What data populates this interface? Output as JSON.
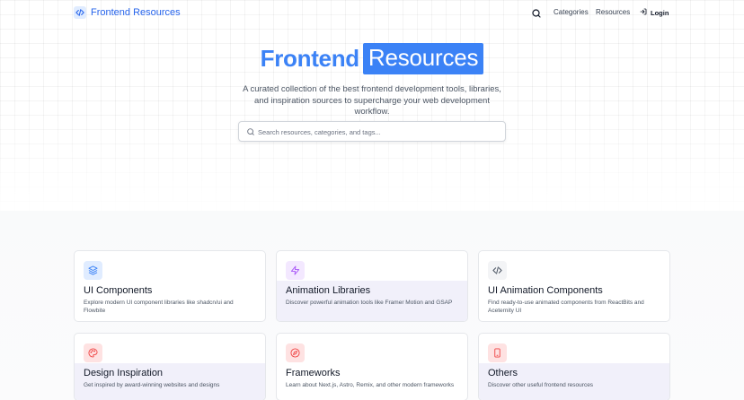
{
  "header": {
    "brand": "Frontend Resources",
    "nav": {
      "categories": "Categories",
      "resources": "Resources",
      "login": "Login"
    }
  },
  "hero": {
    "title_part1": "Frontend",
    "title_part2": "Resources",
    "subtitle": "A curated collection of the best frontend development tools, libraries, and inspiration sources to supercharge your web development workflow.",
    "search_placeholder": "Search resources, categories, and tags..."
  },
  "categories": [
    {
      "title": "UI Components",
      "description": "Explore modern UI component libraries like shadcn/ui and Flowbite",
      "icon": "layers-icon",
      "icon_color": "#3b82f6",
      "icon_bg": "#e0ecff"
    },
    {
      "title": "Animation Libraries",
      "description": "Discover powerful animation tools like Framer Motion and GSAP",
      "icon": "zap-icon",
      "icon_color": "#a855f7",
      "icon_bg": "#f3e8ff"
    },
    {
      "title": "UI Animation Components",
      "description": "Find ready-to-use animated components from ReactBits and Aceternity UI",
      "icon": "code-icon",
      "icon_color": "#4b5563",
      "icon_bg": "#f3f4f6"
    },
    {
      "title": "Design Inspiration",
      "description": "Get inspired by award-winning websites and designs",
      "icon": "palette-icon",
      "icon_color": "#ef4444",
      "icon_bg": "#fee2e2"
    },
    {
      "title": "Frameworks",
      "description": "Learn about Next.js, Astro, Remix, and other modern frameworks",
      "icon": "compass-icon",
      "icon_color": "#ef4444",
      "icon_bg": "#fee2e2"
    },
    {
      "title": "Others",
      "description": "Discover other useful frontend resources",
      "icon": "smartphone-icon",
      "icon_color": "#ef4444",
      "icon_bg": "#fee2e2"
    }
  ],
  "colors": {
    "accent": "#3b82f6",
    "brand": "#2563eb"
  }
}
